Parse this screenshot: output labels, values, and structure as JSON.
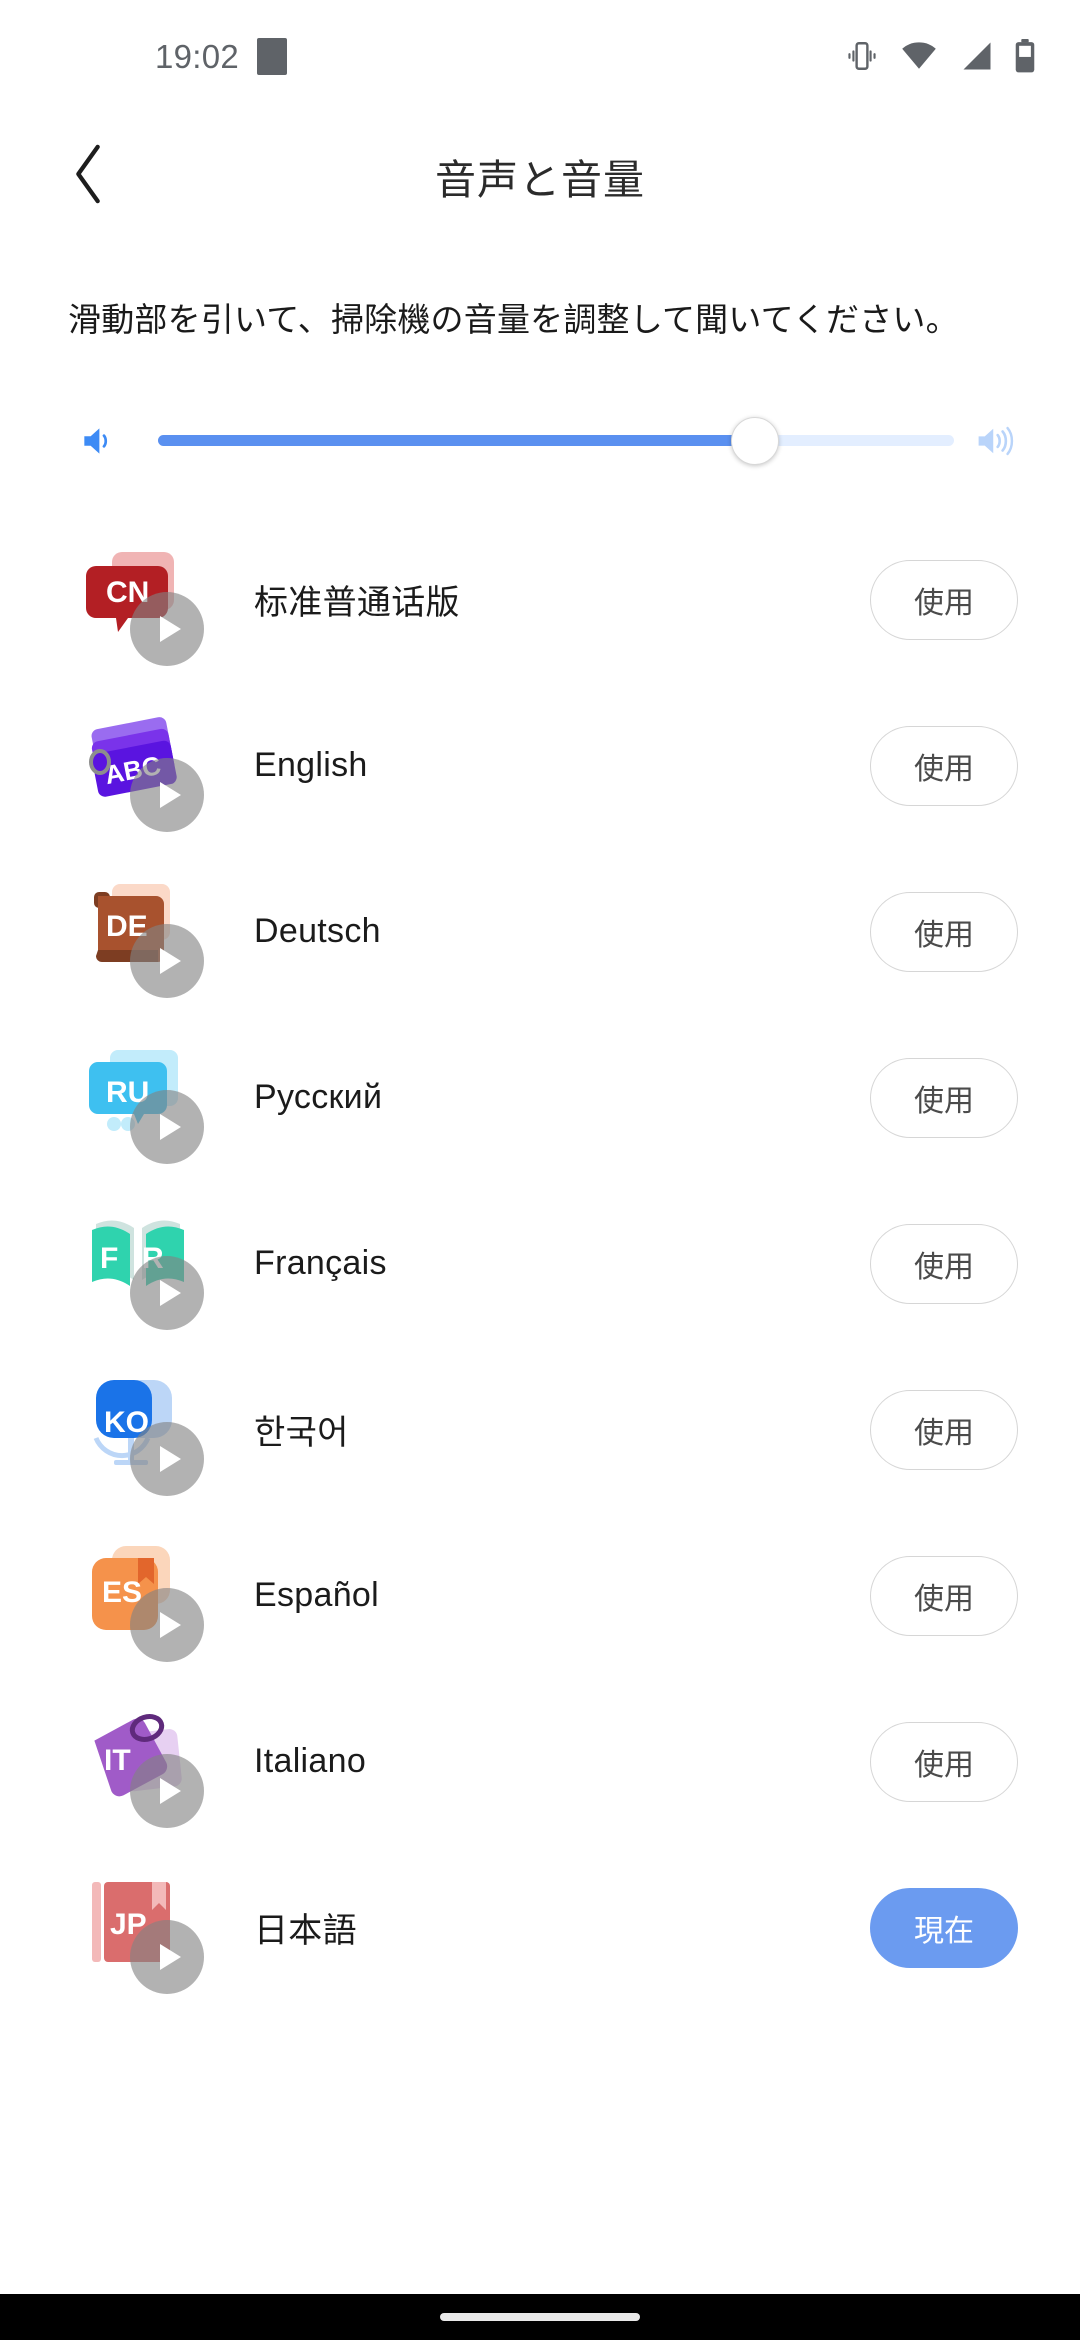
{
  "status_bar": {
    "clock": "19:02",
    "notification_icon": "notification-placeholder-icon",
    "icons": [
      "vibrate-icon",
      "wifi-icon",
      "cellular-signal-icon",
      "battery-icon"
    ]
  },
  "app_bar": {
    "back_icon": "back-chevron-icon",
    "title": "音声と音量"
  },
  "instruction": {
    "text": "滑動部を引いて、掃除機の音量を調整して聞いてください。"
  },
  "volume_slider": {
    "left_icon": "volume-low-icon",
    "right_icon": "volume-high-icon",
    "value_percent": 75,
    "fill_color": "#5a90f0",
    "track_color": "#e3eeff",
    "thumb_color": "#ffffff"
  },
  "buttons": {
    "use_label": "使用",
    "current_label": "現在",
    "active_color": "#6b9bf0",
    "outline_border_color": "#d6d6d6"
  },
  "languages": [
    {
      "code": "CN",
      "label": "标准普通话版",
      "icon": "speech-bubble-cn-icon",
      "color": "#b31f24",
      "accent": "#f0b4b4",
      "action": "使用",
      "active": false
    },
    {
      "code": "ABC",
      "label": "English",
      "icon": "flashcards-abc-icon",
      "color": "#5a14e0",
      "accent": "#9a6cf0",
      "action": "使用",
      "active": false
    },
    {
      "code": "DE",
      "label": "Deutsch",
      "icon": "book-de-icon",
      "color": "#a8522e",
      "accent": "#fbd9c8",
      "action": "使用",
      "active": false
    },
    {
      "code": "RU",
      "label": "Русский",
      "icon": "tag-ru-icon",
      "color": "#3ec0f0",
      "accent": "#c2ecfb",
      "action": "使用",
      "active": false
    },
    {
      "code": "FR",
      "label": "Français",
      "icon": "open-book-fr-icon",
      "color": "#2fd3ae",
      "accent": "#cfe3df",
      "action": "使用",
      "active": false
    },
    {
      "code": "KO",
      "label": "한국어",
      "icon": "microphone-ko-icon",
      "color": "#1a73e8",
      "accent": "#bcd6f7",
      "action": "使用",
      "active": false
    },
    {
      "code": "ES",
      "label": "Español",
      "icon": "bookmark-es-icon",
      "color": "#f5924b",
      "accent": "#fbd6bb",
      "action": "使用",
      "active": false
    },
    {
      "code": "IT",
      "label": "Italiano",
      "icon": "luggage-tag-it-icon",
      "color": "#a05bc8",
      "accent": "#e7d0f2",
      "action": "使用",
      "active": false
    },
    {
      "code": "JP",
      "label": "日本語",
      "icon": "book-jp-icon",
      "color": "#da6d6d",
      "accent": "#f3b9b9",
      "action": "現在",
      "active": true
    }
  ],
  "nav_bar": {
    "home_indicator": "home-indicator"
  }
}
